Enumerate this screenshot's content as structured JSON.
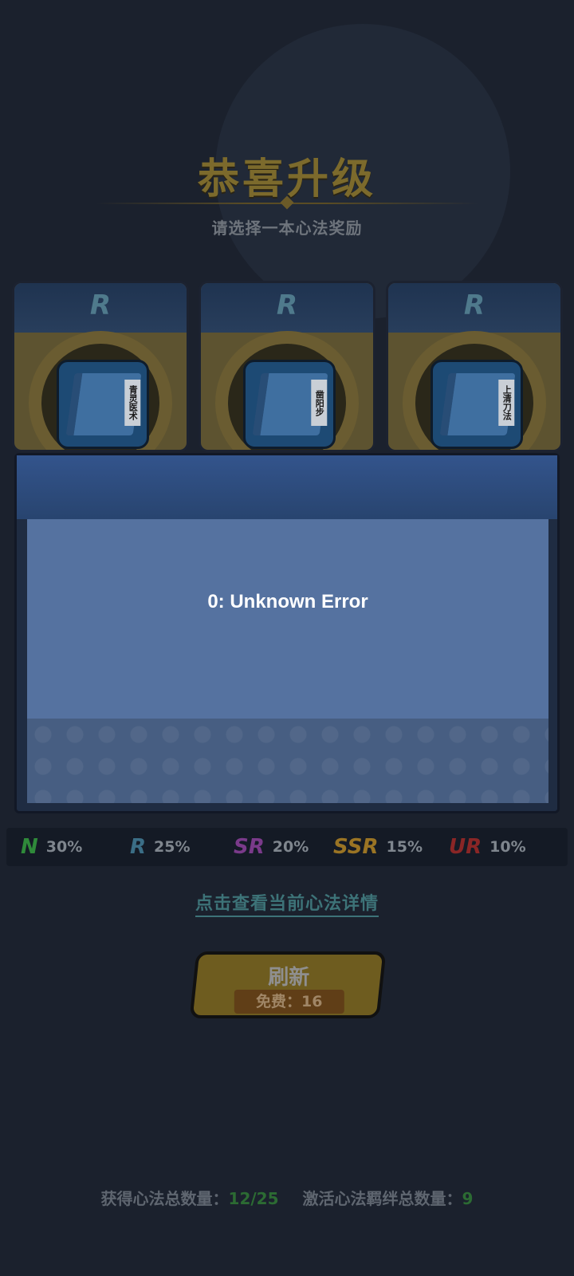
{
  "header": {
    "title": "恭喜升级",
    "subtitle": "请选择一本心法奖励"
  },
  "cards": [
    {
      "rarity": "R",
      "book_name": "青灵医术"
    },
    {
      "rarity": "R",
      "book_name": "凿阳步"
    },
    {
      "rarity": "R",
      "book_name": "上清刀法"
    }
  ],
  "dialog": {
    "message": "0: Unknown Error"
  },
  "rates": [
    {
      "tier": "N",
      "percent": "30%",
      "color": "#2f8a3a"
    },
    {
      "tier": "R",
      "percent": "25%",
      "color": "#3b6e86"
    },
    {
      "tier": "SR",
      "percent": "20%",
      "color": "#7a3a8a"
    },
    {
      "tier": "SSR",
      "percent": "15%",
      "color": "#9a7424"
    },
    {
      "tier": "UR",
      "percent": "10%",
      "color": "#8a2626"
    }
  ],
  "detail_link": "点击查看当前心法详情",
  "refresh_button": {
    "label": "刷新",
    "free_text": "免费：16"
  },
  "stats": {
    "collected_label": "获得心法总数量：",
    "collected_value": "12/25",
    "activated_label": "激活心法羁绊总数量：",
    "activated_value": "9"
  }
}
